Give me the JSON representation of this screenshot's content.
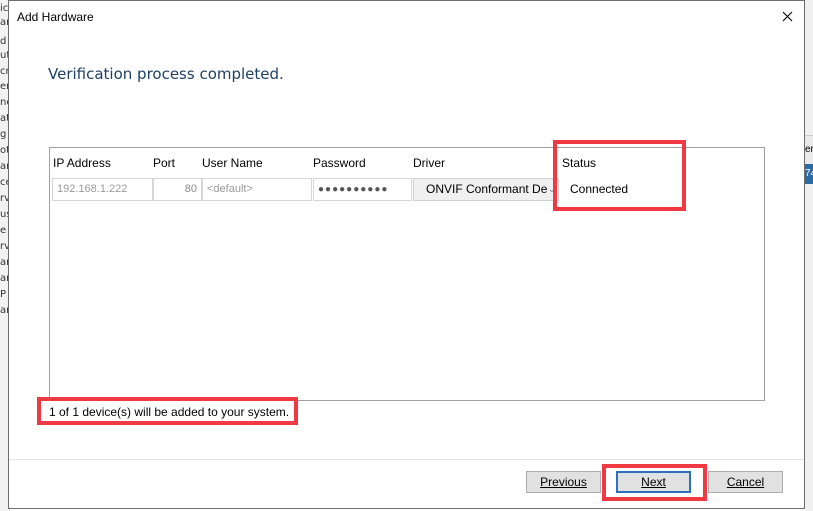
{
  "background": {
    "left_fragments": [
      "ic",
      "ar",
      "d",
      "ut",
      "cr",
      "er",
      "ne",
      "at",
      "g",
      "ot",
      "ar",
      "ce",
      "rv",
      "us",
      "e",
      "rv",
      "ar",
      "ar",
      "P",
      "ar"
    ],
    "right_fragments": [
      "er",
      "74"
    ]
  },
  "dialog": {
    "title": "Add Hardware",
    "close_icon": "close-icon",
    "heading": "Verification process completed."
  },
  "table": {
    "columns": [
      "IP Address",
      "Port",
      "User Name",
      "Password",
      "Driver",
      "Status"
    ],
    "rows": [
      {
        "ip_address": "192.168.1.222",
        "port": "80",
        "user_name": "<default>",
        "password": "●●●●●●●●●●",
        "driver": "ONVIF Conformant De",
        "status": "Connected"
      }
    ]
  },
  "footer_message": "1 of 1 device(s) will be added to your system.",
  "buttons": {
    "previous": "Previous",
    "next": "Next",
    "cancel": "Cancel"
  },
  "highlight_color": "#ef3a43"
}
